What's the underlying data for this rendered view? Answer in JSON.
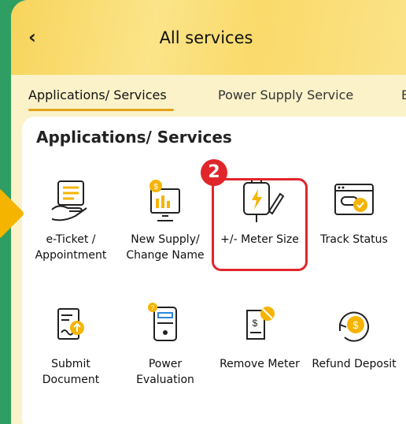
{
  "header": {
    "back_icon": "chevron-left-icon",
    "title": "All services"
  },
  "tabs": [
    {
      "label": "Applications/ Services",
      "active": true
    },
    {
      "label": "Power Supply Service",
      "active": false
    },
    {
      "label": "B",
      "active": false
    }
  ],
  "section": {
    "title": "Applications/ Services",
    "services": [
      {
        "label_1": "e-Ticket /",
        "label_2": "Appointment",
        "icon": "ticket-hand-icon"
      },
      {
        "label_1": "New Supply/",
        "label_2": "Change Name",
        "icon": "coin-document-icon"
      },
      {
        "label_1": "+/- Meter Size",
        "label_2": "",
        "icon": "plug-pen-icon",
        "highlighted": true
      },
      {
        "label_1": "Track Status",
        "label_2": "",
        "icon": "browser-check-icon"
      },
      {
        "label_1": "Submit",
        "label_2": "Document",
        "icon": "document-upload-icon"
      },
      {
        "label_1": "Power",
        "label_2": "Evaluation",
        "icon": "meter-icon"
      },
      {
        "label_1": "Remove Meter",
        "label_2": "",
        "icon": "remove-meter-icon"
      },
      {
        "label_1": "Refund Deposit",
        "label_2": "",
        "icon": "refund-coin-icon"
      }
    ]
  },
  "step_badge": "2",
  "colors": {
    "accent": "#f5b400",
    "highlight": "#e0262b",
    "background": "#2f9e62",
    "icon_stroke": "#222222",
    "icon_blue": "#2b88d8"
  }
}
